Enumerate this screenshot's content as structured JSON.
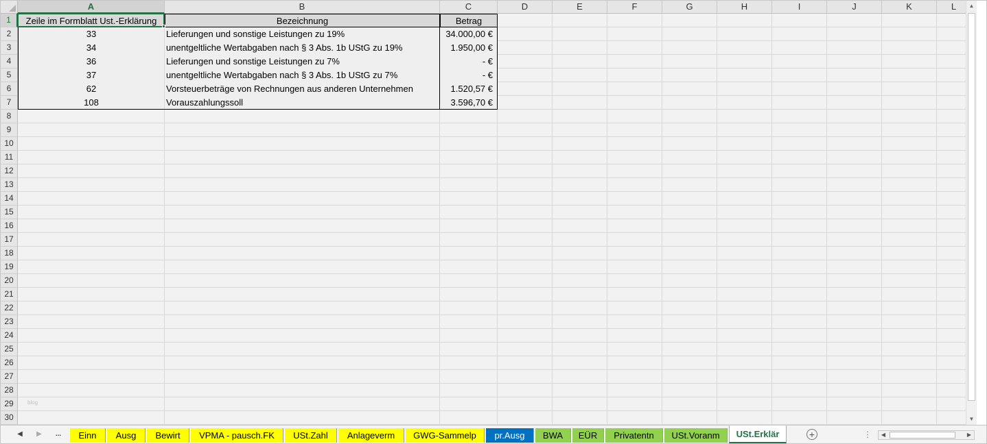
{
  "columns": [
    "A",
    "B",
    "C",
    "D",
    "E",
    "F",
    "G",
    "H",
    "I",
    "J",
    "K",
    "L"
  ],
  "selected_column": "A",
  "rows": [
    "1",
    "2",
    "3",
    "4",
    "5",
    "6",
    "7",
    "8",
    "9",
    "10",
    "11",
    "12",
    "13",
    "14",
    "15",
    "16",
    "17",
    "18",
    "19",
    "20",
    "21",
    "22",
    "23",
    "24",
    "25",
    "26",
    "27",
    "28",
    "29",
    "30"
  ],
  "selected_row": "1",
  "table": {
    "headers": [
      "Zeile im Formblatt Ust.-Erklärung",
      "Bezeichnung",
      "Betrag"
    ],
    "rows": [
      [
        "33",
        "Lieferungen und sonstige Leistungen zu 19%",
        "34.000,00 €"
      ],
      [
        "34",
        "unentgeltliche Wertabgaben nach § 3 Abs. 1b UStG zu 19%",
        "1.950,00 €"
      ],
      [
        "36",
        "Lieferungen und sonstige Leistungen zu 7%",
        "-      €"
      ],
      [
        "37",
        "unentgeltliche Wertabgaben nach § 3 Abs. 1b UStG zu 7%",
        "-      €"
      ],
      [
        "62",
        "Vorsteuerbeträge von Rechnungen aus anderen Unternehmen",
        "1.520,57 €"
      ],
      [
        "108",
        "Vorauszahlungssoll",
        "3.596,70 €"
      ]
    ]
  },
  "watermark": "blog",
  "sheet_nav": {
    "prev": "◀",
    "next": "▶",
    "more": "..."
  },
  "sheet_tabs": [
    {
      "label": "Einn",
      "color": "#ffff00"
    },
    {
      "label": "Ausg",
      "color": "#ffff00"
    },
    {
      "label": "Bewirt",
      "color": "#ffff00"
    },
    {
      "label": "VPMA - pausch.FK",
      "color": "#ffff00"
    },
    {
      "label": "USt.Zahl",
      "color": "#ffff00"
    },
    {
      "label": "Anlageverm",
      "color": "#ffff00"
    },
    {
      "label": "GWG-Sammelp",
      "color": "#ffff00"
    },
    {
      "label": "pr.Ausg",
      "color": "#0070c0"
    },
    {
      "label": "BWA",
      "color": "#92d050"
    },
    {
      "label": "EÜR",
      "color": "#92d050"
    },
    {
      "label": "Privatentn",
      "color": "#92d050"
    },
    {
      "label": "USt.Voranm",
      "color": "#92d050"
    },
    {
      "label": "USt.Erklär",
      "color": "#ffffff",
      "active": true
    }
  ],
  "add_sheet_icon": "plus-circle-icon",
  "colors": {
    "accent": "#217346",
    "header_bg": "#d9d9d9",
    "cell_bg": "#efefef"
  }
}
